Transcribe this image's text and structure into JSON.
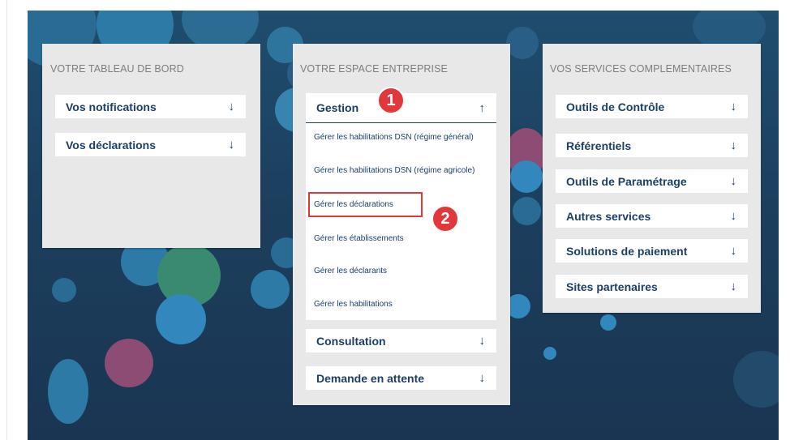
{
  "dashboard": {
    "title": "VOTRE TABLEAU DE BORD",
    "items": [
      {
        "label": "Vos notifications",
        "arrow": "↓"
      },
      {
        "label": "Vos déclarations",
        "arrow": "↓"
      }
    ]
  },
  "enterprise": {
    "title": "VOTRE ESPACE ENTREPRISE",
    "expanded": {
      "label": "Gestion",
      "arrow": "↑",
      "subitems": [
        "Gérer les habilitations DSN (régime général)",
        "Gérer les habilitations DSN (régime agricole)",
        "Gérer les déclarations",
        "Gérer les établissements",
        "Gérer les déclarants",
        "Gérer les habilitations"
      ]
    },
    "items": [
      {
        "label": "Consultation",
        "arrow": "↓"
      },
      {
        "label": "Demande en attente",
        "arrow": "↓"
      }
    ]
  },
  "services": {
    "title": "VOS SERVICES COMPLEMENTAIRES",
    "items": [
      {
        "label": "Outils de Contrôle",
        "arrow": "↓"
      },
      {
        "label": "Référentiels",
        "arrow": "↓"
      },
      {
        "label": "Outils de Paramétrage",
        "arrow": "↓"
      },
      {
        "label": "Autres services",
        "arrow": "↓"
      },
      {
        "label": "Solutions de paiement",
        "arrow": "↓"
      },
      {
        "label": "Sites partenaires",
        "arrow": "↓"
      }
    ]
  },
  "annotations": {
    "step1": "1",
    "step2": "2",
    "highlight_color": "#e2383c"
  }
}
